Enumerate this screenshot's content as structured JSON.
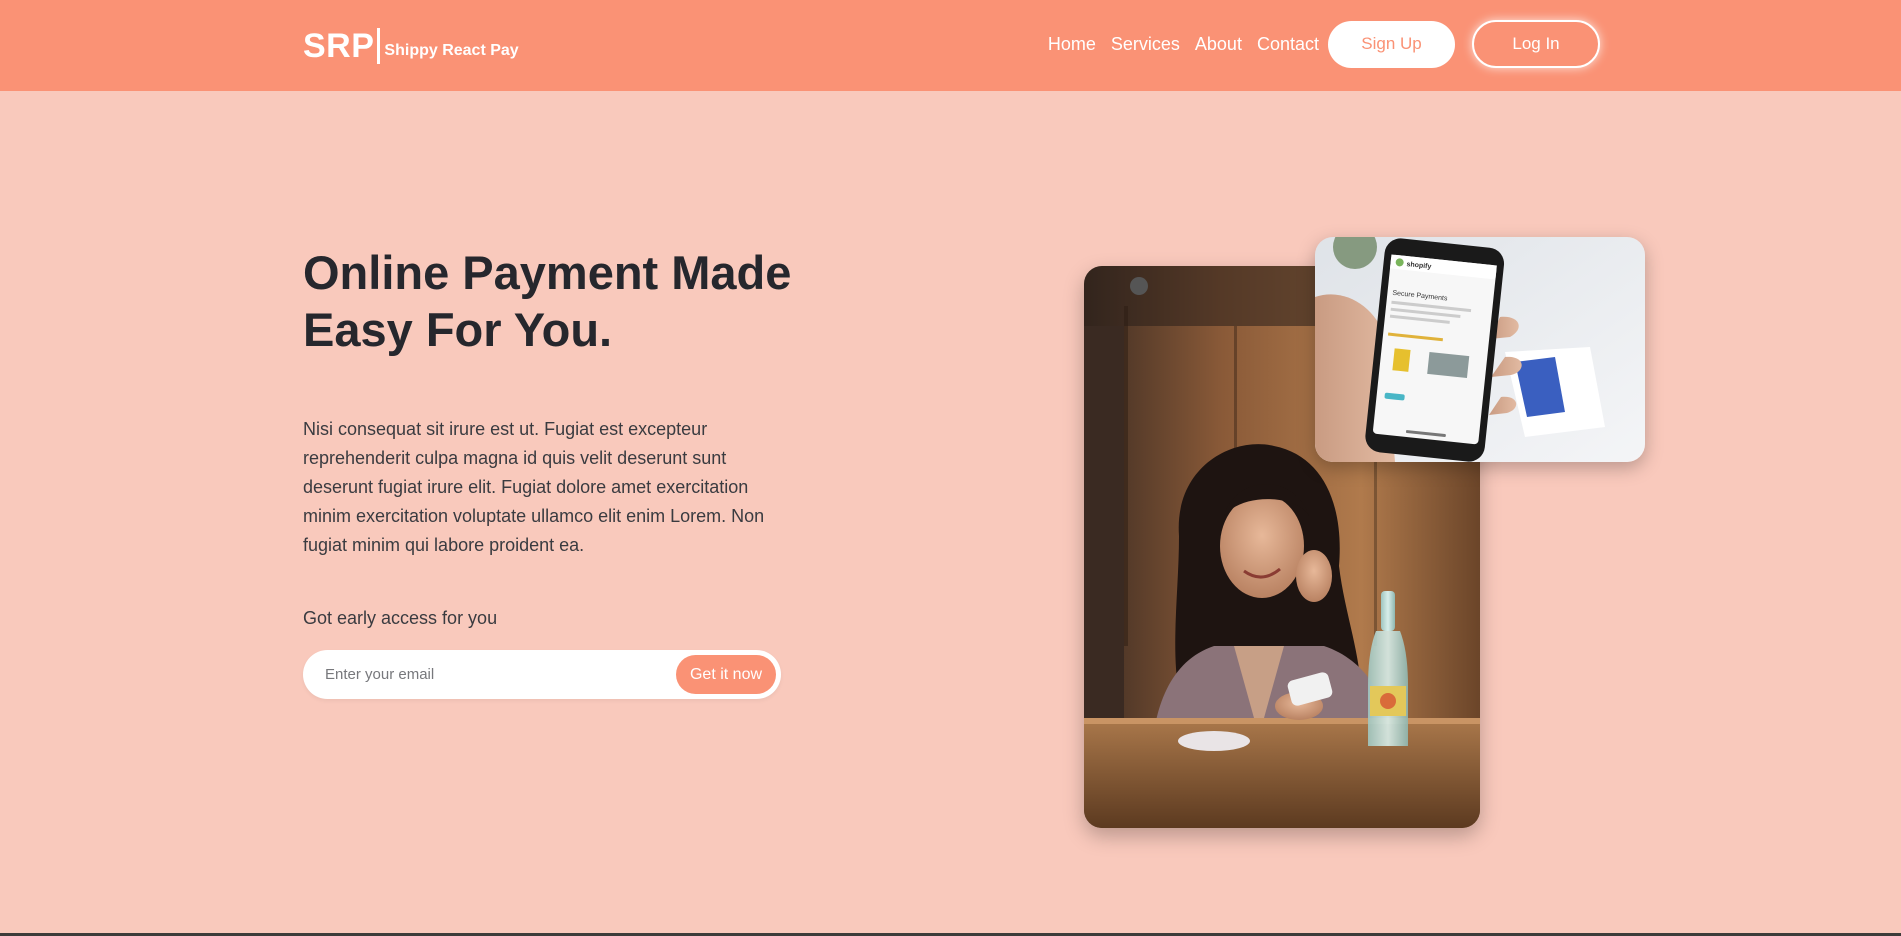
{
  "brand": {
    "mark": "SRP",
    "name": "Shippy React Pay"
  },
  "nav": {
    "links": [
      "Home",
      "Services",
      "About",
      "Contact"
    ],
    "signup_label": "Sign Up",
    "login_label": "Log In"
  },
  "hero": {
    "headline_line1": "Online Payment Made",
    "headline_line2": "Easy For You.",
    "description": "Nisi consequat sit irure est ut. Fugiat est excepteur reprehenderit culpa magna id quis velit deserunt sunt deserunt fugiat irure elit. Fugiat dolore amet exercitation minim exercitation voluptate ullamco elit enim Lorem. Non fugiat minim qui labore proident ea.",
    "early_access_label": "Got early access for you",
    "email_placeholder": "Enter your email",
    "cta_label": "Get it now"
  },
  "phone_screen": {
    "store_name": "shopify",
    "heading": "Secure Payments"
  },
  "colors": {
    "header_bg": "#fa9275",
    "page_bg": "#f9c9bc",
    "accent": "#fa9275",
    "text_dark": "#26272d"
  }
}
